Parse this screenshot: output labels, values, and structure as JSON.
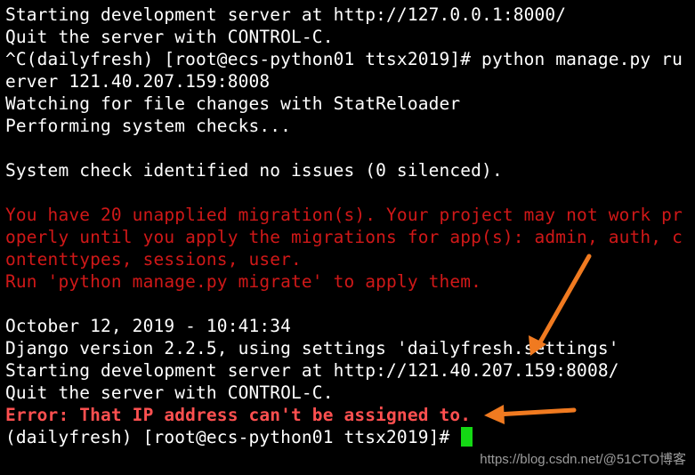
{
  "terminal": {
    "lines": [
      {
        "text": "Starting development server at http://127.0.0.1:8000/",
        "style": "normal"
      },
      {
        "text": "Quit the server with CONTROL-C.",
        "style": "normal"
      },
      {
        "text": "^C(dailyfresh) [root@ecs-python01 ttsx2019]# python manage.py ru",
        "style": "normal"
      },
      {
        "text": "erver 121.40.207.159:8008",
        "style": "normal"
      },
      {
        "text": "Watching for file changes with StatReloader",
        "style": "normal"
      },
      {
        "text": "Performing system checks...",
        "style": "normal"
      },
      {
        "text": "",
        "style": "normal"
      },
      {
        "text": "System check identified no issues (0 silenced).",
        "style": "normal"
      },
      {
        "text": "",
        "style": "normal"
      },
      {
        "text": "You have 20 unapplied migration(s). Your project may not work pr",
        "style": "warn"
      },
      {
        "text": "operly until you apply the migrations for app(s): admin, auth, c",
        "style": "warn"
      },
      {
        "text": "ontenttypes, sessions, user.",
        "style": "warn"
      },
      {
        "text": "Run 'python manage.py migrate' to apply them.",
        "style": "warn"
      },
      {
        "text": "",
        "style": "normal"
      },
      {
        "text": "October 12, 2019 - 10:41:34",
        "style": "normal"
      },
      {
        "text": "Django version 2.2.5, using settings 'dailyfresh.settings'",
        "style": "normal"
      },
      {
        "text": "Starting development server at http://121.40.207.159:8008/",
        "style": "normal"
      },
      {
        "text": "Quit the server with CONTROL-C.",
        "style": "normal"
      },
      {
        "text": "Error: That IP address can't be assigned to.",
        "style": "err"
      }
    ],
    "prompt": "(dailyfresh) [root@ecs-python01 ttsx2019]# ",
    "cursor_color": "#14d814",
    "text_color": "#ffffff",
    "warning_color": "#d01818",
    "error_color": "#ff5050",
    "background_color": "#000000"
  },
  "annotations": {
    "arrow_color": "#f07a20"
  },
  "watermark": {
    "text": "https://blog.csdn.net/@51CTO博客"
  }
}
